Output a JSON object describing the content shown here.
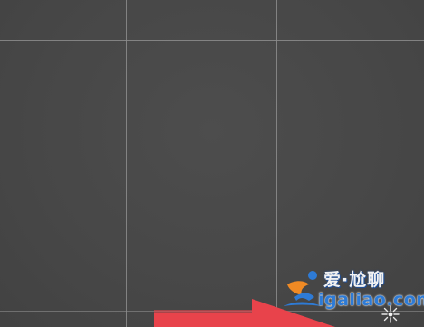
{
  "watermark": {
    "text_cn": "爱·尬聊",
    "text_en": "igaliao.com",
    "colors": {
      "blue": "#2e7bd6",
      "orange": "#f08a24"
    }
  },
  "canvas": {
    "background": "#4a4a4a",
    "grid_color": "#8d8d8d"
  },
  "arrow": {
    "color": "#e8434b",
    "icon": "arrow-right-icon"
  }
}
